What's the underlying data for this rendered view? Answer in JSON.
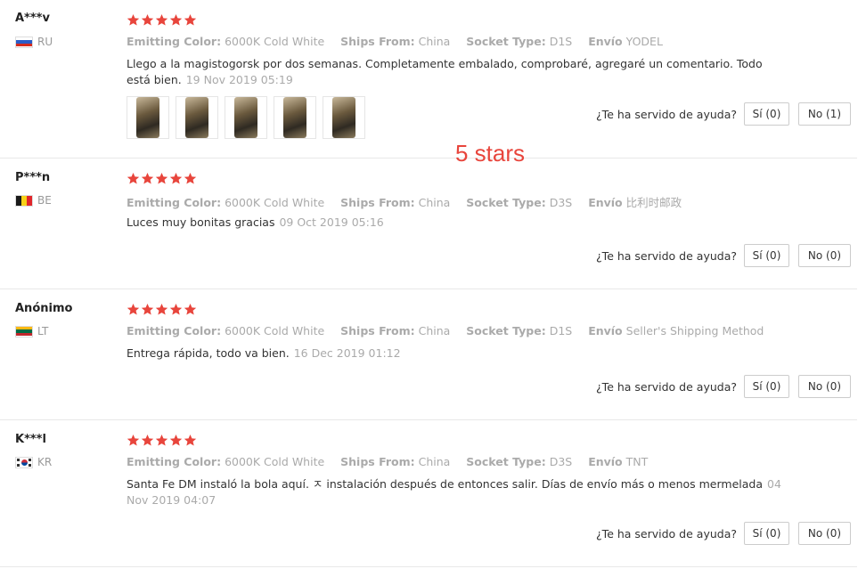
{
  "overlay_label": "5 stars",
  "helpful_question": "¿Te ha servido de ayuda?",
  "prop_keys": {
    "color": "Emitting Color:",
    "ships": "Ships From:",
    "socket": "Socket Type:",
    "envio": "Envío"
  },
  "reviews": [
    {
      "user": "A***v",
      "country": "RU",
      "stars": 5,
      "color": "6000K Cold White",
      "ships": "China",
      "socket": "D1S",
      "envio": "YODEL",
      "comment": "Llego a la magistogorsk por dos semanas. Completamente embalado, comprobaré, agregaré un comentario. Todo está bien.",
      "date": "19 Nov 2019 05:19",
      "photo_count": 5,
      "yes": "Sí (0)",
      "no": "No (1)"
    },
    {
      "user": "P***n",
      "country": "BE",
      "stars": 5,
      "color": "6000K Cold White",
      "ships": "China",
      "socket": "D3S",
      "envio": "比利时邮政",
      "comment": "Luces muy bonitas gracias",
      "date": "09 Oct 2019 05:16",
      "yes": "Sí (0)",
      "no": "No (0)"
    },
    {
      "user": "Anónimo",
      "country": "LT",
      "stars": 5,
      "color": "6000K Cold White",
      "ships": "China",
      "socket": "D1S",
      "envio": "Seller's Shipping Method",
      "comment": "Entrega rápida, todo va bien.",
      "date": "16 Dec 2019 01:12",
      "yes": "Sí (0)",
      "no": "No (0)"
    },
    {
      "user": "K***l",
      "country": "KR",
      "stars": 5,
      "color": "6000K Cold White",
      "ships": "China",
      "socket": "D3S",
      "envio": "TNT",
      "comment": "Santa Fe DM instaló la bola aquí. ㅈ instalación después de entonces salir. Días de envío más o menos mermelada",
      "date": "04 Nov 2019 04:07",
      "yes": "Sí (0)",
      "no": "No (0)"
    }
  ],
  "colors": {
    "star": "#e8453c",
    "overlay": "#e8453c"
  }
}
